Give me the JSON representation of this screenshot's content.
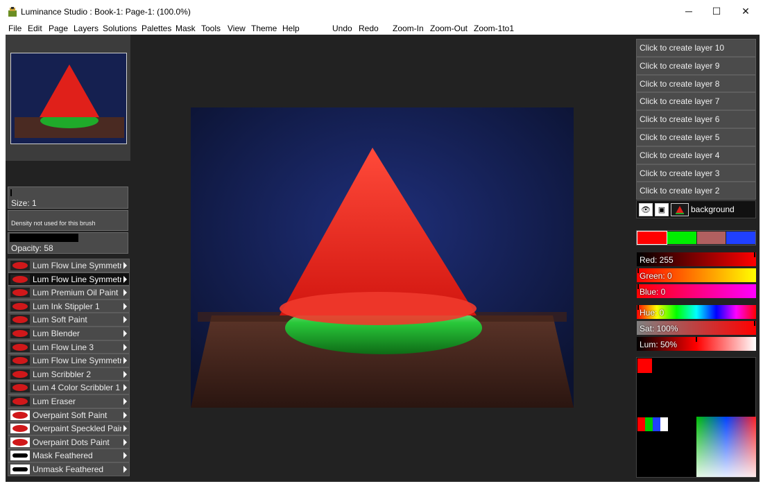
{
  "window": {
    "title": "Luminance Studio : Book-1: Page-1:  (100.0%)",
    "controls": {
      "minimize": "─",
      "maximize": "☐",
      "close": "✕"
    }
  },
  "menu": {
    "items": [
      "File",
      "Edit",
      "Page",
      "Layers",
      "Solutions",
      "Palettes",
      "Mask",
      "Tools",
      "View",
      "Theme",
      "Help"
    ],
    "actions": [
      "Undo",
      "Redo",
      "Zoom-In",
      "Zoom-Out",
      "Zoom-1to1"
    ]
  },
  "brush_settings": {
    "size_label": "Size: 1",
    "density_label": "Density not used for this brush",
    "opacity_label": "Opacity: 58",
    "opacity_value": 0.58
  },
  "brushes": [
    {
      "name": "Lum Flow Line Symmetry",
      "selected": false
    },
    {
      "name": "Lum Flow Line Symmetry",
      "selected": true
    },
    {
      "name": "Lum Premium Oil Paint",
      "selected": false
    },
    {
      "name": "Lum Ink Stippler 1",
      "selected": false
    },
    {
      "name": "Lum Soft Paint",
      "selected": false
    },
    {
      "name": "Lum Blender",
      "selected": false
    },
    {
      "name": "Lum Flow Line 3",
      "selected": false
    },
    {
      "name": "Lum Flow Line Symmetry",
      "selected": false
    },
    {
      "name": "Lum Scribbler 2",
      "selected": false
    },
    {
      "name": "Lum 4 Color Scribbler 1",
      "selected": false
    },
    {
      "name": "Lum Eraser",
      "selected": false
    },
    {
      "name": "Overpaint Soft Paint",
      "selected": false
    },
    {
      "name": "Overpaint Speckled Paint",
      "selected": false
    },
    {
      "name": "Overpaint Dots Paint",
      "selected": false
    },
    {
      "name": "Mask Feathered",
      "selected": false
    },
    {
      "name": "Unmask Feathered",
      "selected": false
    }
  ],
  "layers": {
    "empty_slots": [
      "Click to create layer 10",
      "Click to create layer 9",
      "Click to create layer 8",
      "Click to create layer 7",
      "Click to create layer 6",
      "Click to create layer 5",
      "Click to create layer 4",
      "Click to create layer 3",
      "Click to create layer 2"
    ],
    "background_name": "background"
  },
  "color": {
    "swatches": [
      "#ff0000",
      "#00ee00",
      "#b06060",
      "#2040ff"
    ],
    "red_label": "Red: 255",
    "green_label": "Green: 0",
    "blue_label": "Blue: 0",
    "hue_label": "Hue: 0",
    "sat_label": "Sat: 100%",
    "lum_label": "Lum: 50%",
    "red": 255,
    "green": 0,
    "blue": 0,
    "hue": 0,
    "sat": 100,
    "lum": 50,
    "current": "#ff0000",
    "recent": [
      "#ff0000",
      "#00cc00",
      "#2040ff",
      "#ffffff"
    ]
  }
}
